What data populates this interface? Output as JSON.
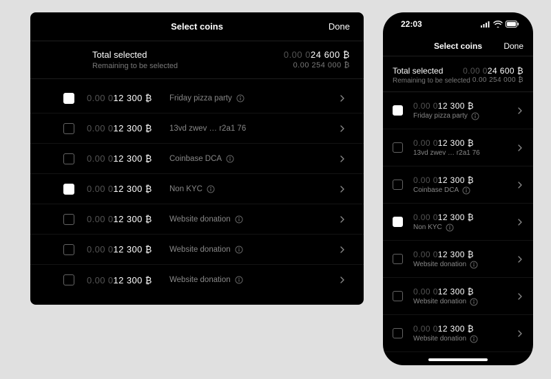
{
  "shared": {
    "title": "Select coins",
    "done": "Done",
    "total_label": "Total selected",
    "remaining_label": "Remaining to be selected",
    "amount_dim": "0.00 0",
    "amount_bright": "24 600 ₿",
    "remaining_amount": "0.00 254 000 ₿",
    "row_amount_dim": "0.00 0",
    "row_amount_bright": "12 300 ₿",
    "rows": [
      {
        "checked": true,
        "label": "Friday pizza party",
        "info": true
      },
      {
        "checked": false,
        "label": "13vd zwev … r2a1 76",
        "info": false
      },
      {
        "checked": false,
        "label": "Coinbase DCA",
        "info": true
      },
      {
        "checked": true,
        "label": "Non KYC",
        "info": true
      },
      {
        "checked": false,
        "label": "Website donation",
        "info": true
      },
      {
        "checked": false,
        "label": "Website donation",
        "info": true
      },
      {
        "checked": false,
        "label": "Website donation",
        "info": true
      }
    ]
  },
  "phone": {
    "time": "22:03"
  }
}
